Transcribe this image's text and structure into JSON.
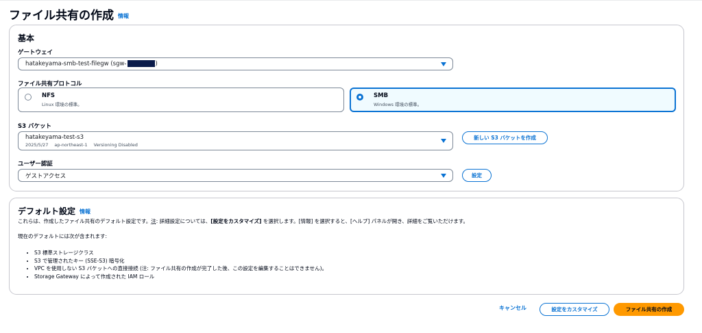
{
  "page": {
    "title": "ファイル共有の作成",
    "info": "情報"
  },
  "basic": {
    "title": "基本",
    "gateway": {
      "label": "ゲートウェイ",
      "value_prefix": "hatakeyama-smb-test-filegw (sgw-",
      "value_suffix": ")"
    },
    "protocol": {
      "label": "ファイル共有プロトコル",
      "options": [
        {
          "name": "NFS",
          "description": "Linux 環境の標準。",
          "selected": false
        },
        {
          "name": "SMB",
          "description": "Windows 環境の標準。",
          "selected": true
        }
      ]
    },
    "bucket": {
      "label": "S3 バケット",
      "value": "hatakeyama-test-s3",
      "date": "2025/5/27",
      "region": "ap-northeast-1",
      "versioning": "Versioning Disabled",
      "new_button": "新しい S3 バケットを作成"
    },
    "auth": {
      "label": "ユーザー認証",
      "value": "ゲストアクセス",
      "settings_button": "設定"
    }
  },
  "defaults": {
    "title": "デフォルト設定",
    "info": "情報",
    "desc_part1": "これらは、作成したファイル共有のデフォルト設定です。",
    "desc_note": "注",
    "desc_part2": ": 詳細設定については、",
    "desc_bold": "[設定をカスタマイズ]",
    "desc_part3": " を選択します。[情報] を選択すると、[ヘルプ] パネルが開き、詳細をご覧いただけます。",
    "current_intro": "現在のデフォルトには次が含まれます:",
    "items": [
      "S3 標準ストレージクラス",
      "S3 で管理されたキー (SSE-S3) 暗号化",
      "VPC を使用しない S3 バケットへの直接接続 (注: ファイル共有の作成が完了した後、この設定を編集することはできません)。",
      "Storage Gateway によって作成された IAM ロール"
    ]
  },
  "footer": {
    "cancel": "キャンセル",
    "customize": "設定をカスタマイズ",
    "create": "ファイル共有の作成"
  },
  "colors": {
    "accent": "#0972d3",
    "primary": "#ff9900",
    "border": "#c6c6cd"
  },
  "icons": {
    "dropdown": "caret-down-icon",
    "radio": "radio-icon"
  }
}
